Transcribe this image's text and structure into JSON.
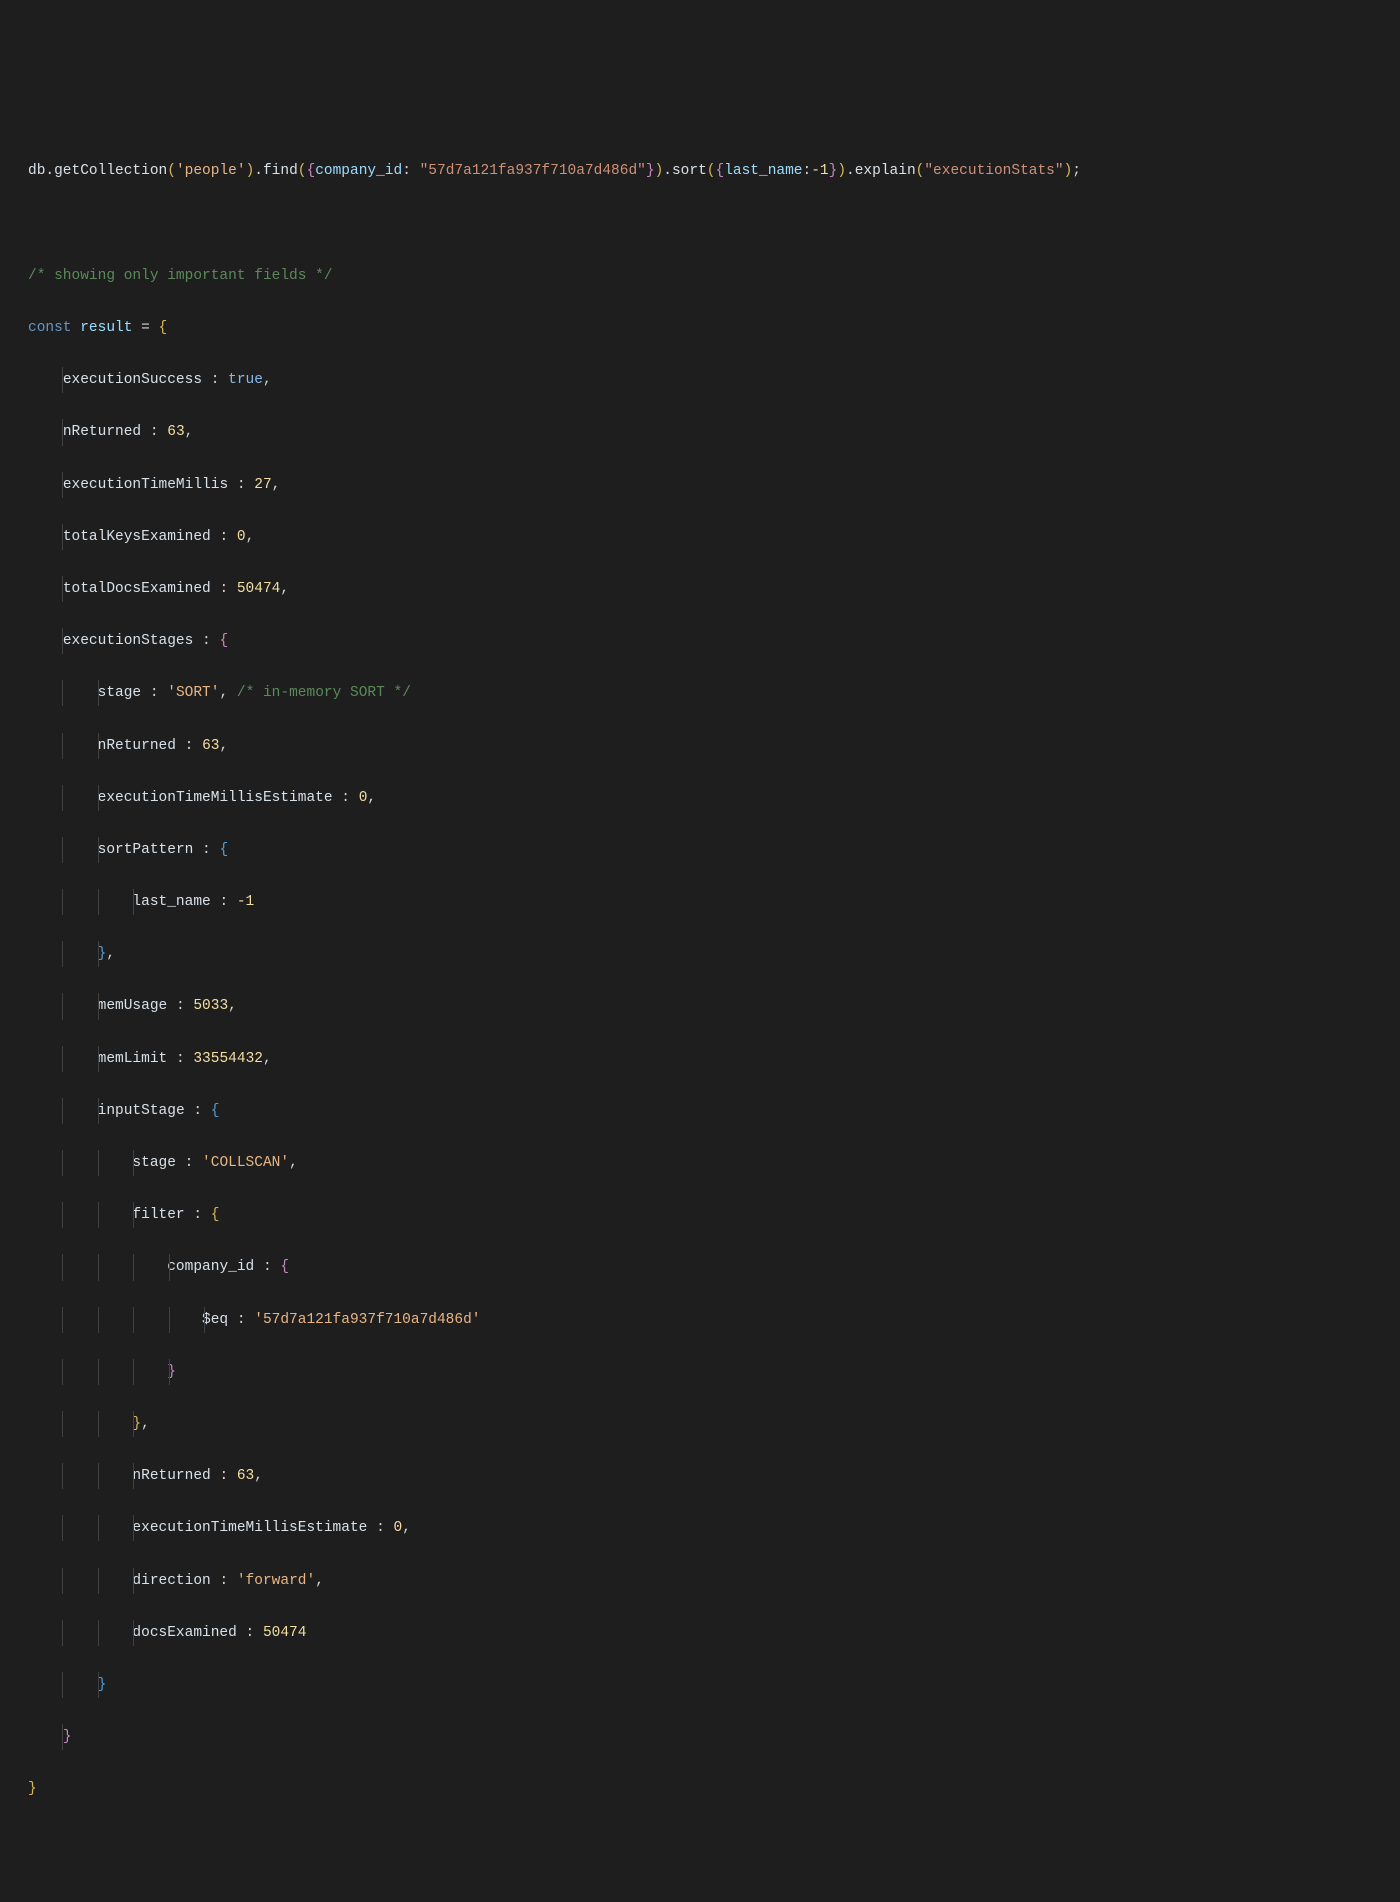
{
  "query": {
    "db": "db",
    "getCollection": ".getCollection",
    "collection": "'people'",
    "find": ".find",
    "companyIdKey": "company_id",
    "companyIdVal": "\"57d7a121fa937f710a7d486d\"",
    "sort": ".sort",
    "sortKey": "last_name",
    "sortVal": "-1",
    "explain": ".explain",
    "explainArg": "\"executionStats\""
  },
  "comment1": "/* showing only important fields */",
  "const": "const",
  "resultVar": "result",
  "result": {
    "executionSuccess": {
      "k": "executionSuccess",
      "v": "true"
    },
    "nReturned": {
      "k": "nReturned",
      "v": "63"
    },
    "executionTimeMillis": {
      "k": "executionTimeMillis",
      "v": "27"
    },
    "totalKeysExamined": {
      "k": "totalKeysExamined",
      "v": "0"
    },
    "totalDocsExamined": {
      "k": "totalDocsExamined",
      "v": "50474"
    },
    "executionStages": {
      "k": "executionStages",
      "stage": {
        "k": "stage",
        "v": "'SORT'"
      },
      "stageComment": "/* in-memory SORT */",
      "nReturned": {
        "k": "nReturned",
        "v": "63"
      },
      "executionTimeMillisEstimate": {
        "k": "executionTimeMillisEstimate",
        "v": "0"
      },
      "sortPattern": {
        "k": "sortPattern",
        "last_name": {
          "k": "last_name",
          "v": "-1"
        }
      },
      "memUsage": {
        "k": "memUsage",
        "v": "5033"
      },
      "memLimit": {
        "k": "memLimit",
        "v": "33554432"
      },
      "inputStage": {
        "k": "inputStage",
        "stage": {
          "k": "stage",
          "v": "'COLLSCAN'"
        },
        "filter": {
          "k": "filter",
          "company_id": {
            "k": "company_id"
          },
          "eq": {
            "k": "$eq",
            "v": "'57d7a121fa937f710a7d486d'"
          }
        },
        "nReturned": {
          "k": "nReturned",
          "v": "63"
        },
        "executionTimeMillisEstimate": {
          "k": "executionTimeMillisEstimate",
          "v": "0"
        },
        "direction": {
          "k": "direction",
          "v": "'forward'"
        },
        "docsExamined": {
          "k": "docsExamined",
          "v": "50474"
        }
      }
    }
  }
}
